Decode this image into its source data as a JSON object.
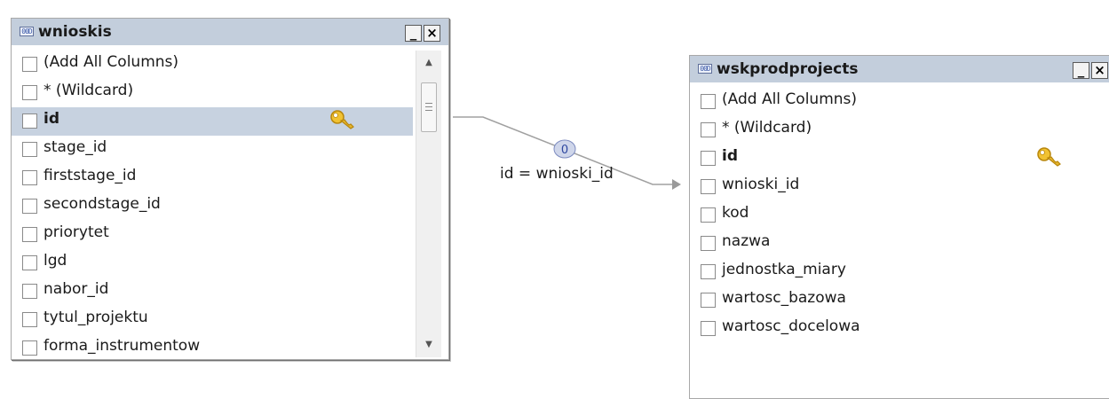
{
  "tables": [
    {
      "title": "wnioskis",
      "icon": "table-icon",
      "icon_glyph": "00D",
      "minimize_glyph": "_",
      "close_glyph": "×",
      "rows": [
        {
          "label": "(Add All Columns)"
        },
        {
          "label": "* (Wildcard)"
        },
        {
          "label": "id",
          "bold": true,
          "selected": true,
          "key": true
        },
        {
          "label": "stage_id"
        },
        {
          "label": "firststage_id"
        },
        {
          "label": "secondstage_id"
        },
        {
          "label": "priorytet"
        },
        {
          "label": "lgd"
        },
        {
          "label": "nabor_id"
        },
        {
          "label": "tytul_projektu"
        },
        {
          "label": "forma_instrumentow"
        }
      ]
    },
    {
      "title": "wskprodprojects",
      "icon": "table-icon",
      "icon_glyph": "00D",
      "minimize_glyph": "_",
      "close_glyph": "×",
      "rows": [
        {
          "label": "(Add All Columns)"
        },
        {
          "label": "* (Wildcard)"
        },
        {
          "label": "id",
          "bold": true,
          "key": true
        },
        {
          "label": "wnioski_id"
        },
        {
          "label": "kod"
        },
        {
          "label": "nazwa"
        },
        {
          "label": "jednostka_miary"
        },
        {
          "label": "wartosc_bazowa"
        },
        {
          "label": "wartosc_docelowa"
        }
      ]
    }
  ],
  "join": {
    "condition": "id = wnioski_id",
    "badge": "0",
    "type_icon": "join-type-icon",
    "color": "#a0a0a0"
  },
  "scrollbar": {
    "up_glyph": "▲",
    "down_glyph": "▼"
  },
  "colors": {
    "header_bg": "#c3cedc",
    "selected_row_bg": "#c7d2e0",
    "key_gold": "#e5b52e"
  }
}
